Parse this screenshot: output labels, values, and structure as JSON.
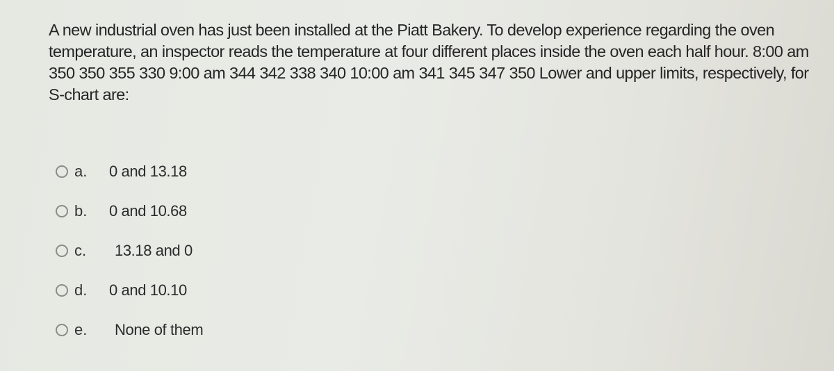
{
  "question": {
    "text": "A new industrial oven has just been installed at the Piatt Bakery. To develop experience regarding the oven temperature, an inspector reads the temperature at four different places inside the oven each half hour. 8:00 am 350 350 355 330 9:00 am 344 342 338 340 10:00 am 341 345 347 350 Lower and upper limits, respectively, for S-chart are:"
  },
  "options": [
    {
      "letter": "a.",
      "text": "0 and 13.18",
      "selected": false
    },
    {
      "letter": "b.",
      "text": "0 and 10.68",
      "selected": false
    },
    {
      "letter": "c.",
      "text": "13.18 and 0",
      "selected": false
    },
    {
      "letter": "d.",
      "text": "0 and 10.10",
      "selected": false
    },
    {
      "letter": "e.",
      "text": "None of them",
      "selected": false
    }
  ]
}
